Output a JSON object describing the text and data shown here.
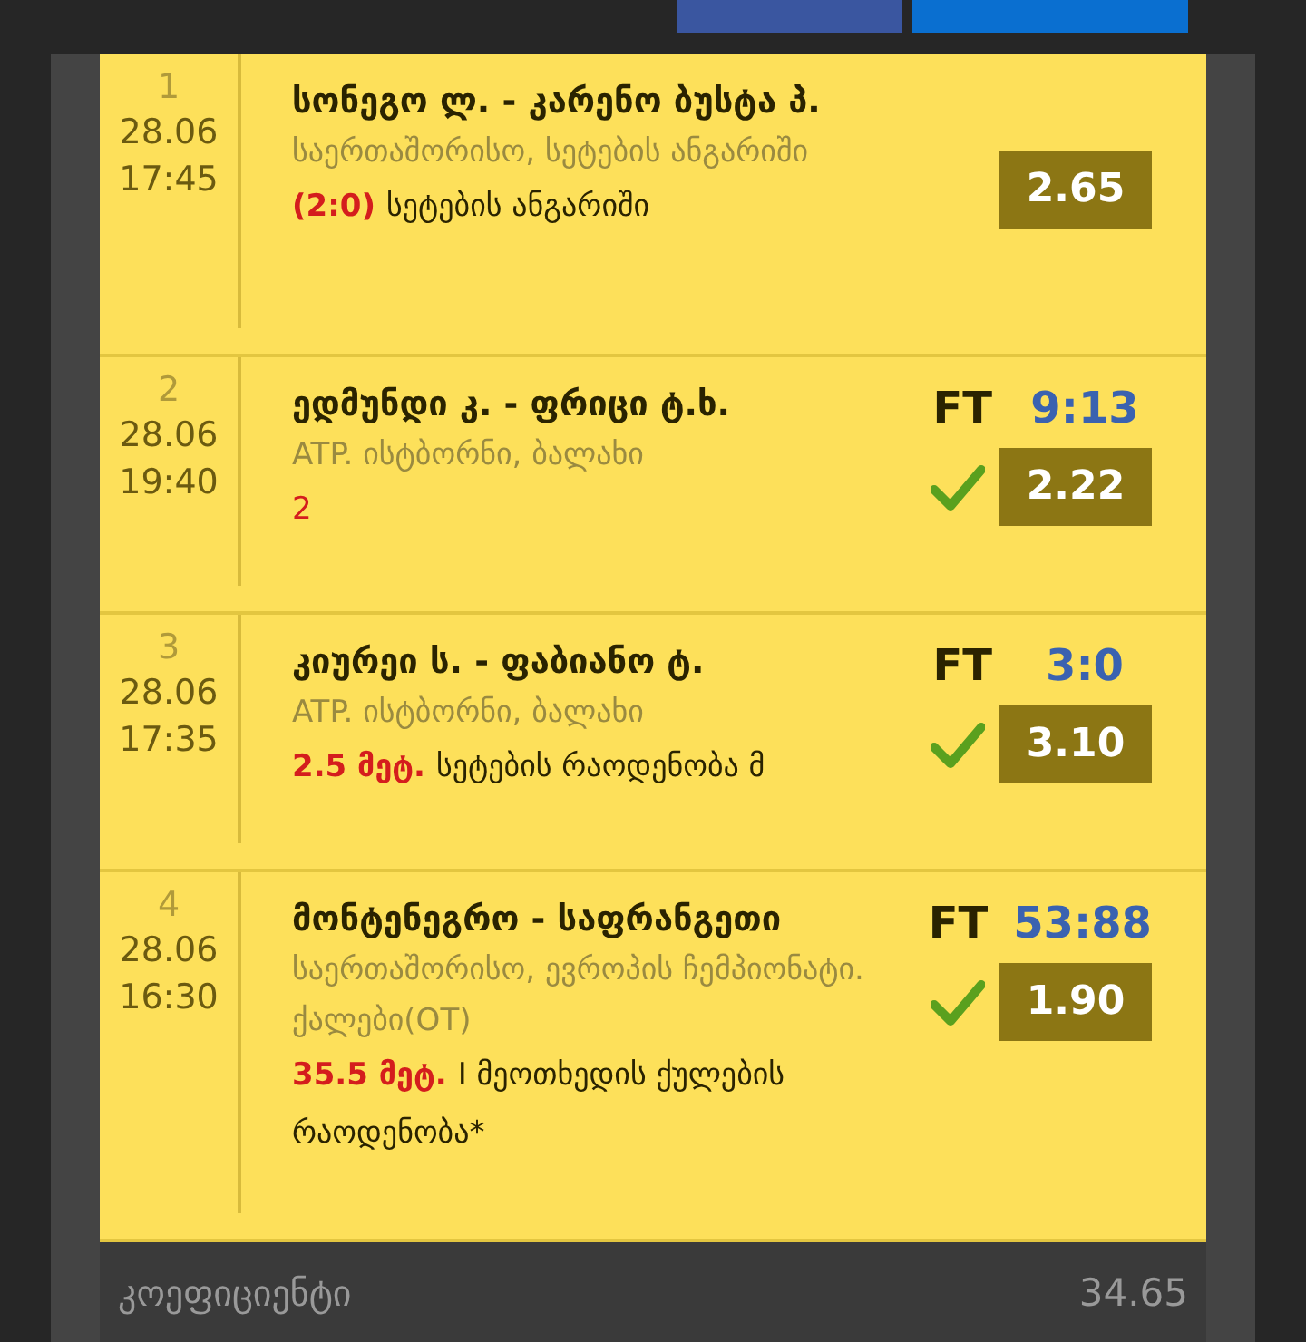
{
  "bets": [
    {
      "index": "1",
      "date": "28.06",
      "time": "17:45",
      "match": "სონეგო ლ. - კარენო ბუსტა პ.",
      "league": "საერთაშორისო, სეტების ანგარიში",
      "pick_value": "(2:0)",
      "pick_text": "სეტების ანგარიში",
      "odds": "2.65",
      "won": false
    },
    {
      "index": "2",
      "date": "28.06",
      "time": "19:40",
      "match": "ედმუნდი კ. - ფრიცი ტ.ხ.",
      "league": "ATP. ისტბორნი, ბალახი",
      "pick_value": "2",
      "status": "FT",
      "score": "9:13",
      "odds": "2.22",
      "won": true
    },
    {
      "index": "3",
      "date": "28.06",
      "time": "17:35",
      "match": "კიურეი ს. - ფაბიანო ტ.",
      "league": "ATP. ისტბორნი, ბალახი",
      "pick_value": "2.5 მეტ.",
      "pick_text": "სეტების რაოდენობა მ",
      "status": "FT",
      "score": "3:0",
      "odds": "3.10",
      "won": true
    },
    {
      "index": "4",
      "date": "28.06",
      "time": "16:30",
      "match": "მონტენეგრო - საფრანგეთი",
      "league": "საერთაშორისო, ევროპის ჩემპიონატი. ქალები(OT)",
      "pick_value": "35.5 მეტ.",
      "pick_text": "I მეოთხედის ქულების რაოდენობა*",
      "status": "FT",
      "score": "53:88",
      "odds": "1.90",
      "won": true
    }
  ],
  "footer": {
    "label": "კოეფიციენტი",
    "value": "34.65"
  }
}
